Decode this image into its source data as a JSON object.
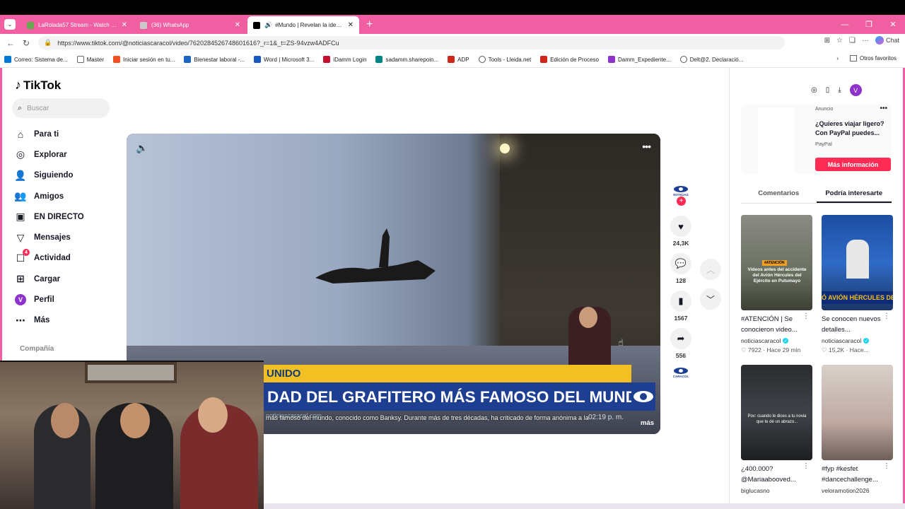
{
  "browser": {
    "tabs": [
      {
        "title": "LaRolada57 Stream - Watch Live o",
        "color": "#6aa84f",
        "active": false
      },
      {
        "title": "(36) WhatsApp",
        "color": "#dddddd",
        "active": false
      },
      {
        "title": "#Mundo | Revelan la identidad",
        "color": "#000000",
        "active": true
      }
    ],
    "url": "https://www.tiktok.com/@noticiascaracol/video/7620284526748601616?_r=1&_t=ZS-94vzw4ADFCu",
    "chat_label": "Chat",
    "bookmarks": [
      {
        "label": "Correo: Sistema de...",
        "color": "#0078d4"
      },
      {
        "label": "Master",
        "color": "#666666"
      },
      {
        "label": "Iniciar sesión en tu...",
        "color": "#f25022"
      },
      {
        "label": "Bienestar laboral -...",
        "color": "#1c64c4"
      },
      {
        "label": "Word | Microsoft 3...",
        "color": "#185abd"
      },
      {
        "label": "iDamm Login",
        "color": "#c8102e"
      },
      {
        "label": "sadamm.sharepoin...",
        "color": "#038387"
      },
      {
        "label": "ADP",
        "color": "#d0271d"
      },
      {
        "label": "Tools - Lleida.net",
        "color": "#555555"
      },
      {
        "label": "Edición de Proceso",
        "color": "#d0271d"
      },
      {
        "label": "Damm_Expediente...",
        "color": "#8d33cc"
      },
      {
        "label": "Delt@2. Declaració...",
        "color": "#555555"
      }
    ],
    "other_favorites": "Otros favoritos"
  },
  "tiktok": {
    "logo": "TikTok",
    "search_placeholder": "Buscar",
    "nav": [
      {
        "label": "Para ti",
        "icon": "home-icon"
      },
      {
        "label": "Explorar",
        "icon": "compass-icon"
      },
      {
        "label": "Siguiendo",
        "icon": "following-icon"
      },
      {
        "label": "Amigos",
        "icon": "friends-icon"
      },
      {
        "label": "EN DIRECTO",
        "icon": "live-icon"
      },
      {
        "label": "Mensajes",
        "icon": "messages-icon"
      },
      {
        "label": "Actividad",
        "icon": "activity-icon",
        "badge": "4"
      },
      {
        "label": "Cargar",
        "icon": "upload-icon"
      },
      {
        "label": "Perfil",
        "icon": "profile-avatar",
        "avatar_letter": "V"
      },
      {
        "label": "Más",
        "icon": "more-icon"
      }
    ],
    "company_label": "Compañía",
    "video": {
      "lower_third": "UNIDO",
      "headline": "DAD DEL GRAFITERO MÁS FAMOSO DEL MUNDO",
      "watermark": "noticiascaracol.com",
      "caption": "más famoso del mundo, conocido como Banksy. Durante más de tres décadas, ha criticado de forma anónima a la",
      "timestamp": "02:19 p. m.",
      "more_label": "más"
    },
    "actions": {
      "likes": "24,3K",
      "comments": "128",
      "saves": "1567",
      "shares": "556"
    },
    "right_panel": {
      "avatar_letter": "V",
      "ad": {
        "label": "Anuncio",
        "title": "¿Quieres viajar ligero? Con PayPal puedes...",
        "brand": "PayPal",
        "cta": "Más información"
      },
      "tabs": [
        "Comentarios",
        "Podría interesarte"
      ],
      "cards": [
        {
          "title": "#ATENCIÓN | Se conocieron video...",
          "author": "noticiascaracol",
          "verified": true,
          "likes": "7922",
          "time": "Hace 29 min",
          "overlay": "Videos antes del accidente del Avión Hércules del Ejército en Putumayo"
        },
        {
          "title": "Se conocen nuevos detalles...",
          "author": "noticiascaracol",
          "verified": true,
          "likes": "15,2K",
          "time": "Hace...",
          "overlay": "Ó AVIÓN HÉRCULES DE"
        },
        {
          "title": "¿400.000? @Mariaabooved...",
          "author": "biglucasno",
          "verified": false,
          "overlay": "Pov: cuando le dices a tu novia que te dé un abrazo..."
        },
        {
          "title": "#fyp #kesfet #dancechallenge...",
          "author": "veloramotion2026",
          "verified": false
        }
      ]
    }
  }
}
